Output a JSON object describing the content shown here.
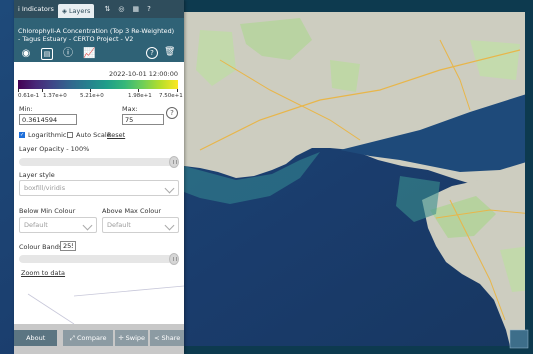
{
  "tabs": [
    {
      "label": "Indicators",
      "icon": "info-icon"
    },
    {
      "label": "Layers",
      "icon": "layers-icon"
    }
  ],
  "header": {
    "title": "Chlorophyll-A Concentration (Top 3 Re-Weighted) - Tagus Estuary - CERTO Project - V2"
  },
  "legend": {
    "date": "2022-10-01 12:00:00",
    "tick_labels": [
      "0.61e-1",
      "1.37e+0",
      "5.21e+0",
      "1.98e+1",
      "7.50e+1"
    ]
  },
  "range": {
    "min_label": "Min:",
    "max_label": "Max:",
    "min_value": "0.3614594",
    "max_value": "75"
  },
  "options": {
    "logarithmic_label": "Logarithmic",
    "logarithmic_checked": true,
    "auto_scale_label": "Auto Scale",
    "reset_label": "Reset"
  },
  "opacity": {
    "label": "Layer Opacity - 100%",
    "value_percent": 100
  },
  "style": {
    "label": "Layer style",
    "value": "boxfill/viridis"
  },
  "below": {
    "label": "Below Min Colour",
    "value": "Default"
  },
  "above": {
    "label": "Above Max Colour",
    "value": "Default"
  },
  "bands": {
    "label": "Colour Bands:",
    "value": "255"
  },
  "zoom": {
    "label": "Zoom to data"
  },
  "toolbar": {
    "about": "About",
    "compare": "Compare",
    "swipe": "Swipe",
    "share": "Share"
  },
  "colors": {
    "header": "#2f6276",
    "tabbar": "#2f4d5c",
    "ocean": "#1a3f6e",
    "land": "#c8c8b8"
  }
}
